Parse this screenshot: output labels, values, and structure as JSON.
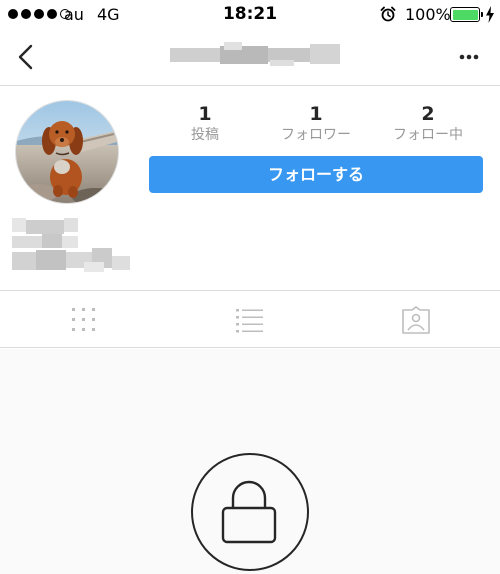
{
  "status_bar": {
    "carrier": "au",
    "network": "4G",
    "time": "18:21",
    "battery": "100%"
  },
  "nav": {
    "back_icon": "chevron-left-icon",
    "more_icon": "ellipsis-icon"
  },
  "profile": {
    "stats": [
      {
        "value": "1",
        "label": "投稿"
      },
      {
        "value": "1",
        "label": "フォロワー"
      },
      {
        "value": "2",
        "label": "フォロー中"
      }
    ],
    "follow_label": "フォローする"
  },
  "tabs": [
    {
      "icon": "grid-icon"
    },
    {
      "icon": "list-icon"
    },
    {
      "icon": "tagged-photos-icon"
    }
  ],
  "colors": {
    "accent": "#3897f0",
    "battery": "#4cd964",
    "private_bg": "#fafafa"
  }
}
